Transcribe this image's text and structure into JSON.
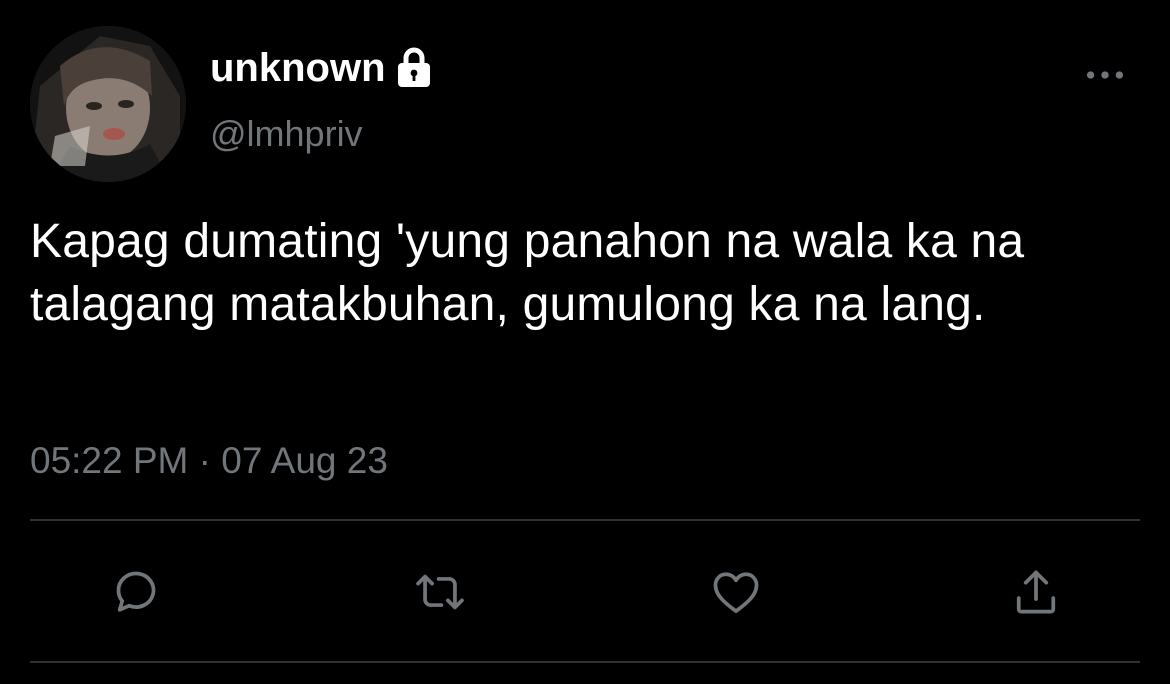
{
  "tweet": {
    "display_name": "unknown",
    "handle": "@lmhpriv",
    "text": "Kapag dumating 'yung panahon na wala ka na talagang matakbuhan, gumulong ka na lang.",
    "timestamp": "05:22 PM · 07 Aug 23",
    "protected": true
  },
  "icons": {
    "lock": "lock-icon",
    "more": "more-horizontal-icon",
    "reply": "reply-icon",
    "retweet": "retweet-icon",
    "like": "heart-icon",
    "share": "share-icon"
  },
  "colors": {
    "background": "#000000",
    "primary_text": "#ffffff",
    "secondary_text": "#71767b",
    "divider": "#2f3336"
  }
}
